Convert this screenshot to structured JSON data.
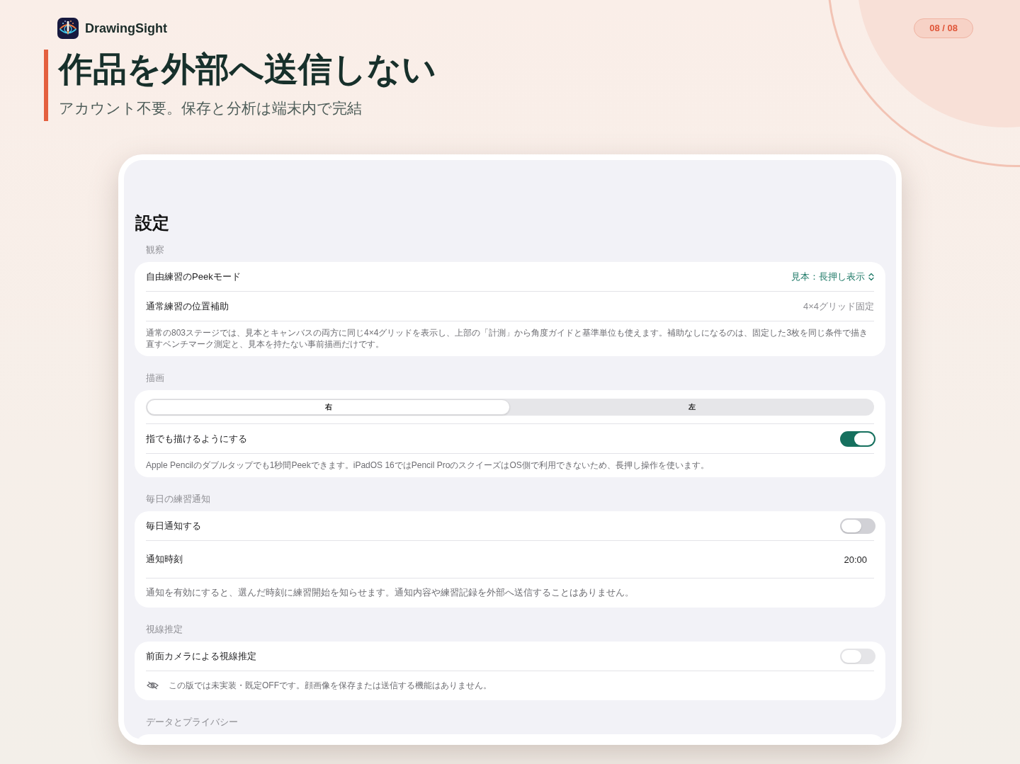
{
  "brand": {
    "name": "DrawingSight"
  },
  "page_counter": "08 / 08",
  "headline": {
    "title": "作品を外部へ送信しない",
    "subtitle": "アカウント不要。保存と分析は端末内で完結"
  },
  "device": {
    "screen_title": "設定",
    "sections": [
      {
        "header": "観察",
        "rows": [
          {
            "kind": "picker",
            "label": "自由練習のPeekモード",
            "value": "見本：長押し表示"
          },
          {
            "kind": "value",
            "label": "通常練習の位置補助",
            "value": "4×4グリッド固定"
          }
        ],
        "footnote": {
          "kind": "caption",
          "text": "通常の803ステージでは、見本とキャンバスの両方に同じ4×4グリッドを表示し、上部の「計測」から角度ガイドと基準単位も使えます。補助なしになるのは、固定した3枚を同じ条件で描き直すベンチマーク測定と、見本を持たない事前描画だけです。"
        }
      },
      {
        "header": "描画",
        "rows": [
          {
            "kind": "segmented",
            "segments": [
              {
                "label": "右",
                "selected": true
              },
              {
                "label": "左",
                "selected": false
              }
            ]
          },
          {
            "kind": "toggle",
            "label": "指でも描けるようにする",
            "on": true,
            "disabled": false
          }
        ],
        "footnote": {
          "kind": "caption",
          "text": "Apple Pencilのダブルタップでも1秒間Peekできます。iPadOS 16ではPencil ProのスクイーズはOS側で利用できないため、長押し操作を使います。"
        }
      },
      {
        "header": "毎日の練習通知",
        "rows": [
          {
            "kind": "toggle",
            "label": "毎日通知する",
            "on": false,
            "disabled": false
          },
          {
            "kind": "time",
            "label": "通知時刻",
            "value": "20:00"
          }
        ],
        "footnote": {
          "kind": "body",
          "text": "通知を有効にすると、選んだ時刻に練習開始を知らせます。通知内容や練習記録を外部へ送信することはありません。"
        }
      },
      {
        "header": "視線推定",
        "rows": [
          {
            "kind": "toggle",
            "label": "前面カメラによる視線推定",
            "on": false,
            "disabled": true
          }
        ],
        "footnote": {
          "kind": "hint",
          "text": "この版では未実装・既定OFFです。顔画像を保存または送信する機能はありません。"
        }
      },
      {
        "header": "データとプライバシー"
      }
    ]
  }
}
